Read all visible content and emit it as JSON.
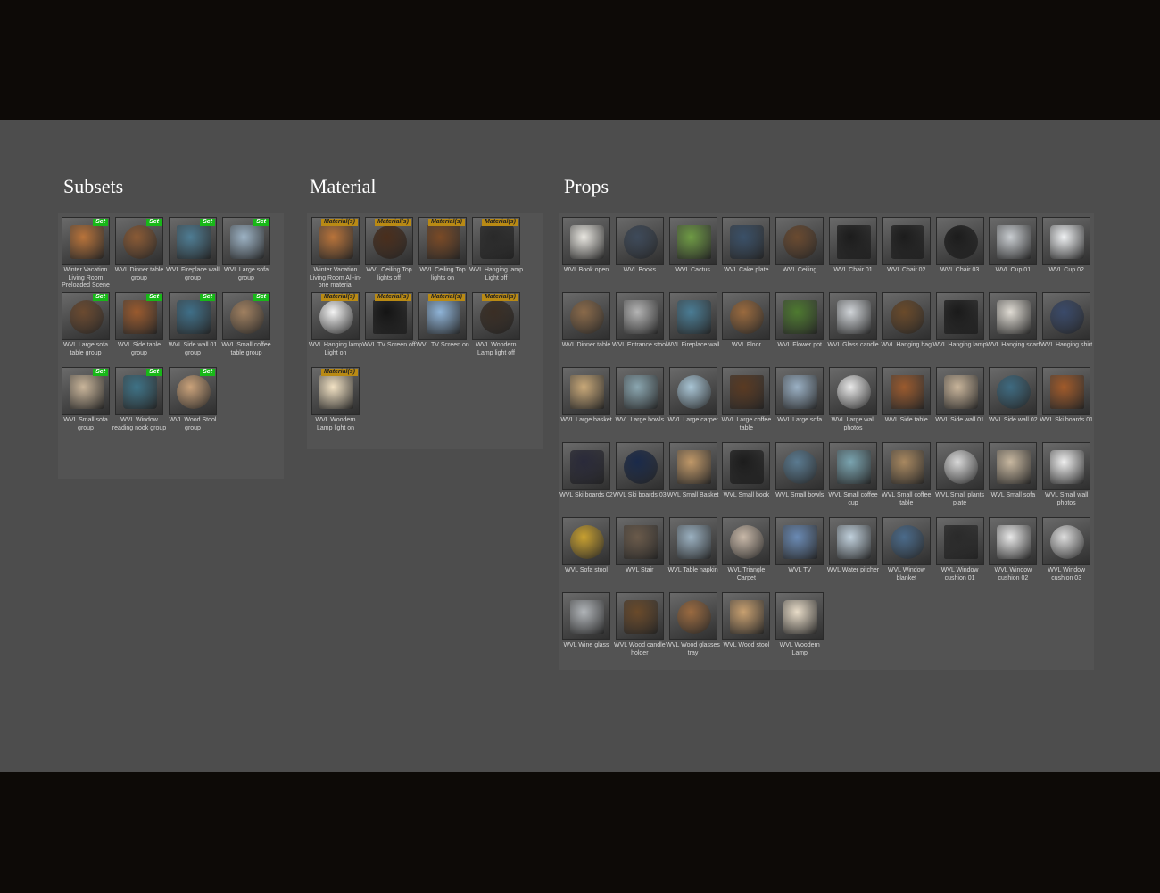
{
  "sections": {
    "subsets": {
      "title": "Subsets",
      "badge": "Set",
      "items": [
        {
          "label": "Winter Vacation Living Room Preloaded Scene",
          "icon": "living-room-scene-icon",
          "color": "#b8733a"
        },
        {
          "label": "WVL Dinner table group",
          "icon": "dinner-table-group-icon",
          "color": "#8a5a35"
        },
        {
          "label": "WVL Fireplace wall group",
          "icon": "fireplace-wall-icon",
          "color": "#4e7c93"
        },
        {
          "label": "WVL Large sofa group",
          "icon": "large-sofa-group-icon",
          "color": "#9cb2c4"
        },
        {
          "label": "WVL Large sofa table group",
          "icon": "large-sofa-table-icon",
          "color": "#6b4a30"
        },
        {
          "label": "WVL Side table group",
          "icon": "side-table-group-icon",
          "color": "#9a5a2e"
        },
        {
          "label": "WVL Side wall 01 group",
          "icon": "side-wall-group-icon",
          "color": "#3f6f88"
        },
        {
          "label": "WVL Small coffee table group",
          "icon": "coffee-table-group-icon",
          "color": "#a08060"
        },
        {
          "label": "WVL Small sofa group",
          "icon": "small-sofa-group-icon",
          "color": "#c9b59a"
        },
        {
          "label": "WVL Window reading nook group",
          "icon": "reading-nook-icon",
          "color": "#3e7286"
        },
        {
          "label": "WVL Wood Stool group",
          "icon": "wood-stool-group-icon",
          "color": "#caa27a"
        }
      ]
    },
    "material": {
      "title": "Material",
      "badge": "Material(s)",
      "items": [
        {
          "label": "Winter Vacation Living Room All-in-one material",
          "icon": "living-room-material-icon",
          "color": "#b8733a"
        },
        {
          "label": "WVL Ceiling Top lights off",
          "icon": "ceiling-lights-off-icon",
          "color": "#4a2e1c"
        },
        {
          "label": "WVL Ceiling Top lights on",
          "icon": "ceiling-lights-on-icon",
          "color": "#7a4a26"
        },
        {
          "label": "WVL Hanging lamp Light off",
          "icon": "hanging-lamp-off-icon",
          "color": "#2a2a2a"
        },
        {
          "label": "WVL Hanging lamp Light on",
          "icon": "hanging-lamp-on-icon",
          "color": "#f4f4f4"
        },
        {
          "label": "WVL TV Screen off",
          "icon": "tv-screen-off-icon",
          "color": "#141414"
        },
        {
          "label": "WVL TV Screen on",
          "icon": "tv-screen-on-icon",
          "color": "#8fb4d8"
        },
        {
          "label": "WVL Woodern Lamp light off",
          "icon": "wooden-lamp-off-icon",
          "color": "#3a2e24"
        },
        {
          "label": "WVL Woodern Lamp light on",
          "icon": "wooden-lamp-on-icon",
          "color": "#f2e2c4"
        }
      ]
    },
    "props": {
      "title": "Props",
      "items": [
        {
          "label": "WVL Book open",
          "icon": "book-open-icon",
          "color": "#e8e6e0"
        },
        {
          "label": "WVL Books",
          "icon": "books-icon",
          "color": "#3e4a5a"
        },
        {
          "label": "WVL Cactus",
          "icon": "cactus-icon",
          "color": "#6e9a44"
        },
        {
          "label": "WVL Cake plate",
          "icon": "cake-plate-icon",
          "color": "#3a5068"
        },
        {
          "label": "WVL Ceiling",
          "icon": "ceiling-icon",
          "color": "#6a4a30"
        },
        {
          "label": "WVL Chair 01",
          "icon": "chair-icon",
          "color": "#1c1c1c"
        },
        {
          "label": "WVL Chair 02",
          "icon": "chair-icon",
          "color": "#1c1c1c"
        },
        {
          "label": "WVL Chair 03",
          "icon": "chair-icon",
          "color": "#1c1c1c"
        },
        {
          "label": "WVL Cup 01",
          "icon": "cup-icon",
          "color": "#c8ccd0"
        },
        {
          "label": "WVL Cup 02",
          "icon": "cup-icon",
          "color": "#eef0f2"
        },
        {
          "label": "WVL Dinner table",
          "icon": "dinner-table-icon",
          "color": "#8a6a4a"
        },
        {
          "label": "WVL Entrance stool",
          "icon": "entrance-stool-icon",
          "color": "#b4b4b4"
        },
        {
          "label": "WVL Fireplace wall",
          "icon": "fireplace-wall-icon",
          "color": "#4a7c94"
        },
        {
          "label": "WVL Floor",
          "icon": "floor-icon",
          "color": "#9a6a3e"
        },
        {
          "label": "WVL Flower pot",
          "icon": "flower-pot-icon",
          "color": "#4e7a30"
        },
        {
          "label": "WVL Glass candle",
          "icon": "glass-candle-icon",
          "color": "#d0d4d8"
        },
        {
          "label": "WVL Hanging bag",
          "icon": "hanging-bag-icon",
          "color": "#6a4a2a"
        },
        {
          "label": "WVL Hanging lamp",
          "icon": "hanging-lamp-icon",
          "color": "#1a1a1a"
        },
        {
          "label": "WVL Hanging scarf",
          "icon": "scarf-icon",
          "color": "#e0dcd4"
        },
        {
          "label": "WVL Hanging shirt",
          "icon": "shirt-icon",
          "color": "#3a4a6a"
        },
        {
          "label": "WVL Large basket",
          "icon": "basket-icon",
          "color": "#c8a878"
        },
        {
          "label": "WVL Large bowls",
          "icon": "bowl-icon",
          "color": "#8aa6b0"
        },
        {
          "label": "WVL Large carpet",
          "icon": "carpet-icon",
          "color": "#a8c4d4"
        },
        {
          "label": "WVL Large coffee table",
          "icon": "coffee-table-icon",
          "color": "#5a3a22"
        },
        {
          "label": "WVL Large sofa",
          "icon": "sofa-icon",
          "color": "#9ab0c4"
        },
        {
          "label": "WVL Large wall photos",
          "icon": "wall-photos-icon",
          "color": "#e8e8e8"
        },
        {
          "label": "WVL Side table",
          "icon": "side-table-icon",
          "color": "#9a5a2e"
        },
        {
          "label": "WVL Side wall 01",
          "icon": "side-wall-icon",
          "color": "#c8b49a"
        },
        {
          "label": "WVL Side wall 02",
          "icon": "side-wall-icon",
          "color": "#3e6a80"
        },
        {
          "label": "WVL Ski boards 01",
          "icon": "ski-boards-icon",
          "color": "#a05a2a"
        },
        {
          "label": "WVL Ski boards 02",
          "icon": "ski-boards-icon",
          "color": "#2a2a3a"
        },
        {
          "label": "WVL Ski boards 03",
          "icon": "ski-boards-icon",
          "color": "#1a2a4a"
        },
        {
          "label": "WVL Small Basket",
          "icon": "basket-icon",
          "color": "#c09868"
        },
        {
          "label": "WVL Small book",
          "icon": "book-icon",
          "color": "#1c1c1c"
        },
        {
          "label": "WVL Small bowls",
          "icon": "bowl-icon",
          "color": "#5a7a90"
        },
        {
          "label": "WVL Small coffee cup",
          "icon": "coffee-cup-icon",
          "color": "#7aa4b0"
        },
        {
          "label": "WVL Small coffee table",
          "icon": "coffee-table-icon",
          "color": "#a88860"
        },
        {
          "label": "WVL Small plants plate",
          "icon": "plants-plate-icon",
          "color": "#d8d8d8"
        },
        {
          "label": "WVL Small sofa",
          "icon": "sofa-icon",
          "color": "#c8b8a0"
        },
        {
          "label": "WVL Small wall photos",
          "icon": "wall-photos-icon",
          "color": "#eeeeee"
        },
        {
          "label": "WVL Sofa stool",
          "icon": "sofa-stool-icon",
          "color": "#c8a030"
        },
        {
          "label": "WVL Stair",
          "icon": "stair-icon",
          "color": "#6a5a4a"
        },
        {
          "label": "WVL Table napkin",
          "icon": "napkin-icon",
          "color": "#9ab0c0"
        },
        {
          "label": "WVL Triangle Carpet",
          "icon": "triangle-carpet-icon",
          "color": "#c8b8a8"
        },
        {
          "label": "WVL TV",
          "icon": "tv-icon",
          "color": "#6a8ab4"
        },
        {
          "label": "WVL Water pitcher",
          "icon": "water-pitcher-icon",
          "color": "#c0d0dc"
        },
        {
          "label": "WVL Window blanket",
          "icon": "blanket-icon",
          "color": "#4a6a8a"
        },
        {
          "label": "WVL Window cushion 01",
          "icon": "cushion-icon",
          "color": "#2a2a2a"
        },
        {
          "label": "WVL Window cushion 02",
          "icon": "cushion-icon",
          "color": "#e8e8e8"
        },
        {
          "label": "WVL Window cushion 03",
          "icon": "cushion-icon",
          "color": "#dcdcdc"
        },
        {
          "label": "WVL Wine glass",
          "icon": "wine-glass-icon",
          "color": "#b0b4b8"
        },
        {
          "label": "WVL Wood candle holder",
          "icon": "candle-holder-icon",
          "color": "#6a4a2a"
        },
        {
          "label": "WVL Wood glasses tray",
          "icon": "glasses-tray-icon",
          "color": "#9a6a40"
        },
        {
          "label": "WVL Wood stool",
          "icon": "wood-stool-icon",
          "color": "#c8a070"
        },
        {
          "label": "WVL Woodern Lamp",
          "icon": "wooden-lamp-icon",
          "color": "#e8dcc8"
        }
      ]
    }
  }
}
